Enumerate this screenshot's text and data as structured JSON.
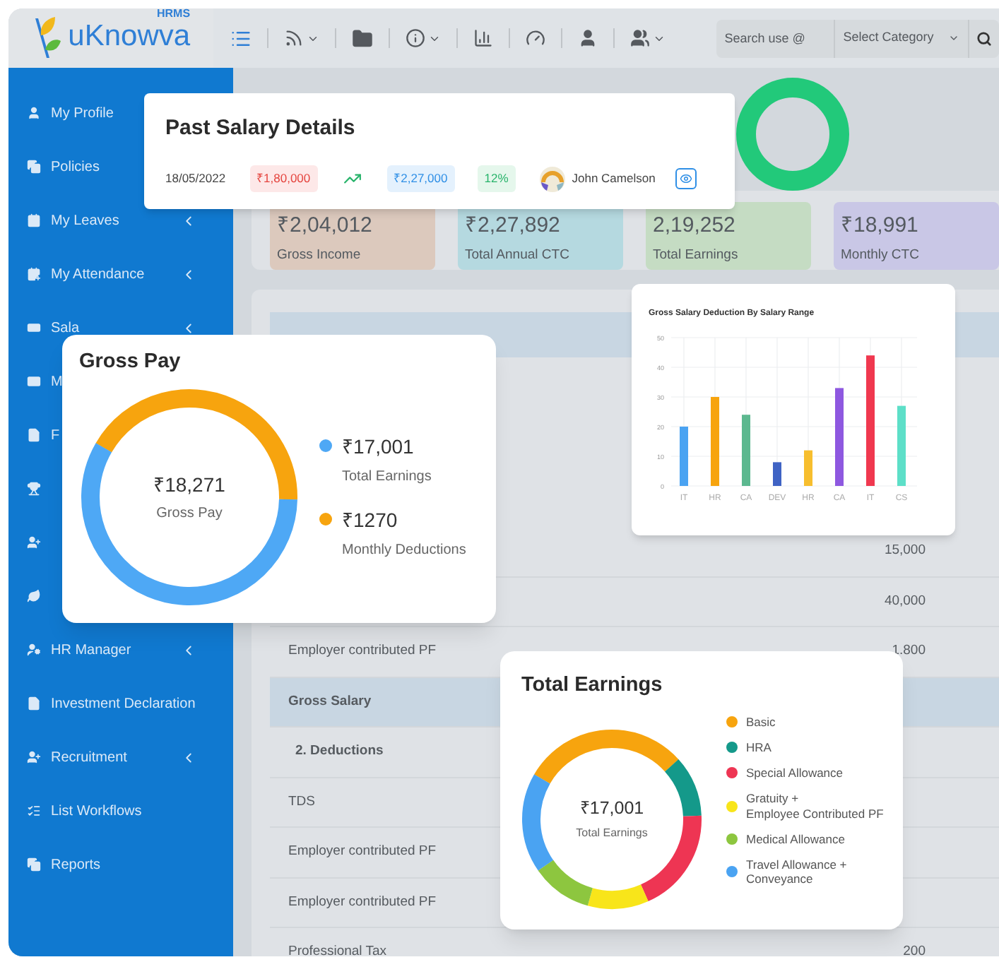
{
  "header": {
    "logo": {
      "name": "uKnowva",
      "tag": "HRMS"
    },
    "search": {
      "placeholder": "Search use @"
    },
    "category": {
      "value": "Select Category"
    }
  },
  "sidebar": {
    "items": [
      {
        "label": "My Profile",
        "expandable": false
      },
      {
        "label": "Policies",
        "expandable": false
      },
      {
        "label": "My Leaves",
        "expandable": true
      },
      {
        "label": "My Attendance",
        "expandable": true
      },
      {
        "label": "Sala",
        "expandable": true
      },
      {
        "label": "M",
        "expandable": false
      },
      {
        "label": "F",
        "expandable": false
      },
      {
        "expandable": false
      },
      {
        "expandable": false
      },
      {
        "expandable": false
      },
      {
        "label": "HR Manager",
        "expandable": true
      },
      {
        "label": "Investment Declaration",
        "expandable": false
      },
      {
        "label": "Recruitment",
        "expandable": true
      },
      {
        "label": "List Workflows",
        "expandable": false
      },
      {
        "label": "Reports",
        "expandable": false
      }
    ]
  },
  "stats": [
    {
      "value": "₹2,04,012",
      "label": "Gross Income",
      "color": "#dcc9bd"
    },
    {
      "value": "₹2,27,892",
      "label": "Total Annual CTC",
      "color": "#b5d9e0"
    },
    {
      "value": "2,19,252",
      "label": "Total Earnings",
      "color": "#c5dcc3"
    },
    {
      "value": "₹18,991",
      "label": "Monthly CTC",
      "color": "#c9c7e6"
    }
  ],
  "salary_table": {
    "rows": [
      {
        "value": "15,000",
        "kind": "normal"
      },
      {
        "value": "40,000",
        "kind": "normal"
      },
      {
        "label": "Employer contributed PF",
        "value": "1.800",
        "kind": "normal"
      },
      {
        "label": "Gross Salary",
        "kind": "total"
      },
      {
        "label": "2. Deductions",
        "kind": "section"
      },
      {
        "label": "TDS",
        "kind": "normal"
      },
      {
        "label": "Employer contributed PF",
        "kind": "normal"
      },
      {
        "label": "Employer contributed PF",
        "kind": "normal"
      },
      {
        "label": "Professional Tax",
        "value": "200",
        "kind": "normal"
      }
    ]
  },
  "past_salary": {
    "title": "Past Salary Details",
    "date": "18/05/2022",
    "old_amount": "₹1,80,000",
    "new_amount": "₹2,27,000",
    "change": "12%",
    "employee": "John Camelson"
  },
  "gross_pay": {
    "title": "Gross Pay",
    "center_value": "₹18,271",
    "center_label": "Gross Pay",
    "legend": [
      {
        "value": "₹17,001",
        "label": "Total Earnings",
        "color": "#4ea8f5"
      },
      {
        "value": "₹1270",
        "label": "Monthly Deductions",
        "color": "#f7a40e"
      }
    ]
  },
  "deduction_chart": {
    "chart_data": {
      "type": "bar",
      "title": "Gross Salary Deduction By Salary Range",
      "categories": [
        "IT",
        "HR",
        "CA",
        "DEV",
        "HR",
        "CA",
        "IT",
        "CS"
      ],
      "series": [
        {
          "values": [
            20,
            30,
            24,
            8,
            12,
            33,
            44,
            27
          ]
        }
      ],
      "ylim": [
        0,
        50
      ],
      "yticks": [
        0,
        10,
        20,
        30,
        40,
        50
      ],
      "grid": true
    }
  },
  "total_earnings": {
    "title": "Total Earnings",
    "center_value": "₹17,001",
    "center_label": "Total Earnings",
    "legend": [
      {
        "label": "Basic",
        "color": "#f7a40e"
      },
      {
        "label": "HRA",
        "color": "#14998a"
      },
      {
        "label": "Special Allowance",
        "color": "#ee3553"
      },
      {
        "label": "Gratuity +\nEmployee Contributed PF",
        "color": "#f8e51a"
      },
      {
        "label": "Medical Allowance",
        "color": "#8dc63f"
      },
      {
        "label": "Travel Allowance +\nConveyance",
        "color": "#4aa3f2"
      }
    ]
  }
}
